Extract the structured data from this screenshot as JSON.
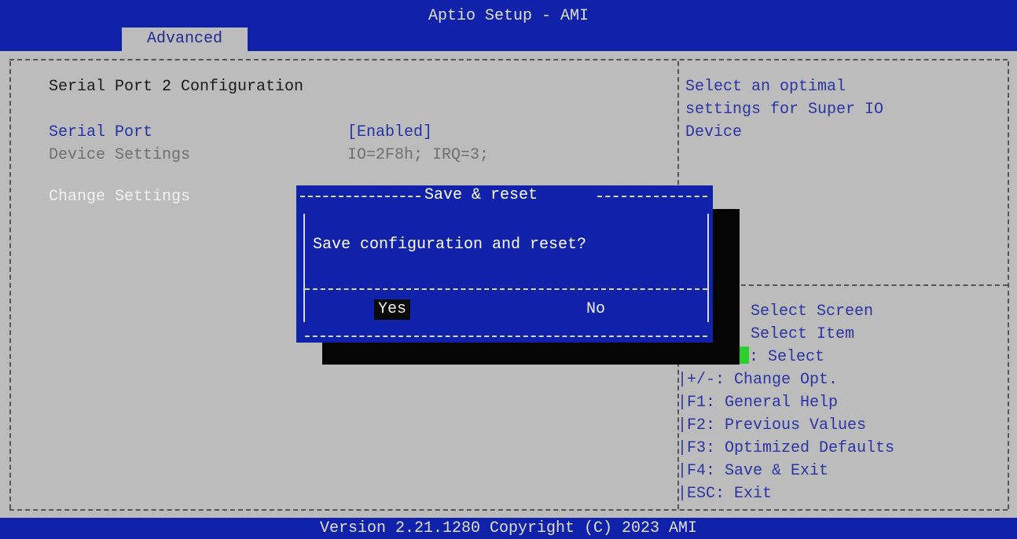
{
  "app": {
    "title": "Aptio Setup - AMI",
    "tab": "Advanced"
  },
  "main": {
    "heading": "Serial Port 2 Configuration",
    "serial_port_label": "Serial Port",
    "serial_port_value": "[Enabled]",
    "device_settings_label": "Device Settings",
    "device_settings_value": "IO=2F8h; IRQ=3;",
    "change_settings_label": "Change Settings"
  },
  "help": {
    "lines": [
      "Select an optimal",
      "settings for Super IO",
      "Device"
    ]
  },
  "keys": {
    "lines": [
      "Select Screen",
      "Select Item",
      ": Select",
      "|+/-: Change Opt.",
      "|F1: General Help",
      "|F2: Previous Values",
      "|F3: Optimized Defaults",
      "|F4: Save & Exit",
      "|ESC: Exit"
    ]
  },
  "dialog": {
    "title": "Save & reset",
    "message": "Save configuration and reset?",
    "yes": "Yes",
    "no": "No"
  },
  "footer": {
    "version": "Version 2.21.1280 Copyright (C) 2023 AMI"
  },
  "colors": {
    "bar": "#1122aa",
    "background": "#bcbcbc",
    "dialog": "#1122aa",
    "cursor": "#2ad12a"
  }
}
